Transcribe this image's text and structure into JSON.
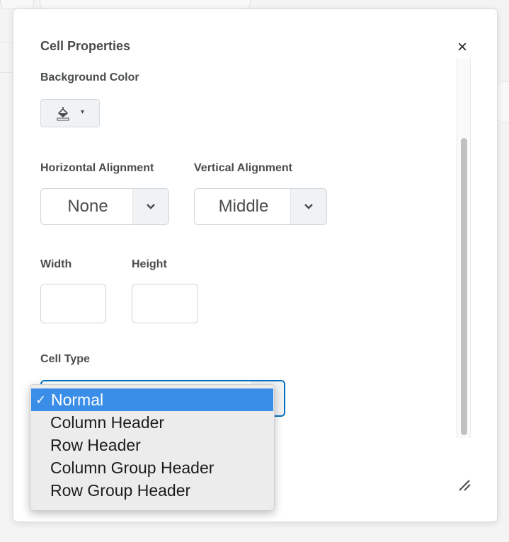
{
  "dialog": {
    "title": "Cell Properties",
    "close_glyph": "×",
    "background_color": {
      "label": "Background Color",
      "button_icon": "paint-bucket-icon",
      "caret": "▾"
    },
    "horizontal_alignment": {
      "label": "Horizontal Alignment",
      "value": "None"
    },
    "vertical_alignment": {
      "label": "Vertical Alignment",
      "value": "Middle"
    },
    "width": {
      "label": "Width",
      "value": ""
    },
    "height": {
      "label": "Height",
      "value": ""
    },
    "cell_type": {
      "label": "Cell Type",
      "check_glyph": "✓",
      "options": [
        "Normal",
        "Column Header",
        "Row Header",
        "Column Group Header",
        "Row Group Header"
      ],
      "selected": "Normal"
    }
  },
  "colors": {
    "accent": "#006fbf",
    "selected_option": "#3b8ee8",
    "label_text": "#494c4e"
  }
}
